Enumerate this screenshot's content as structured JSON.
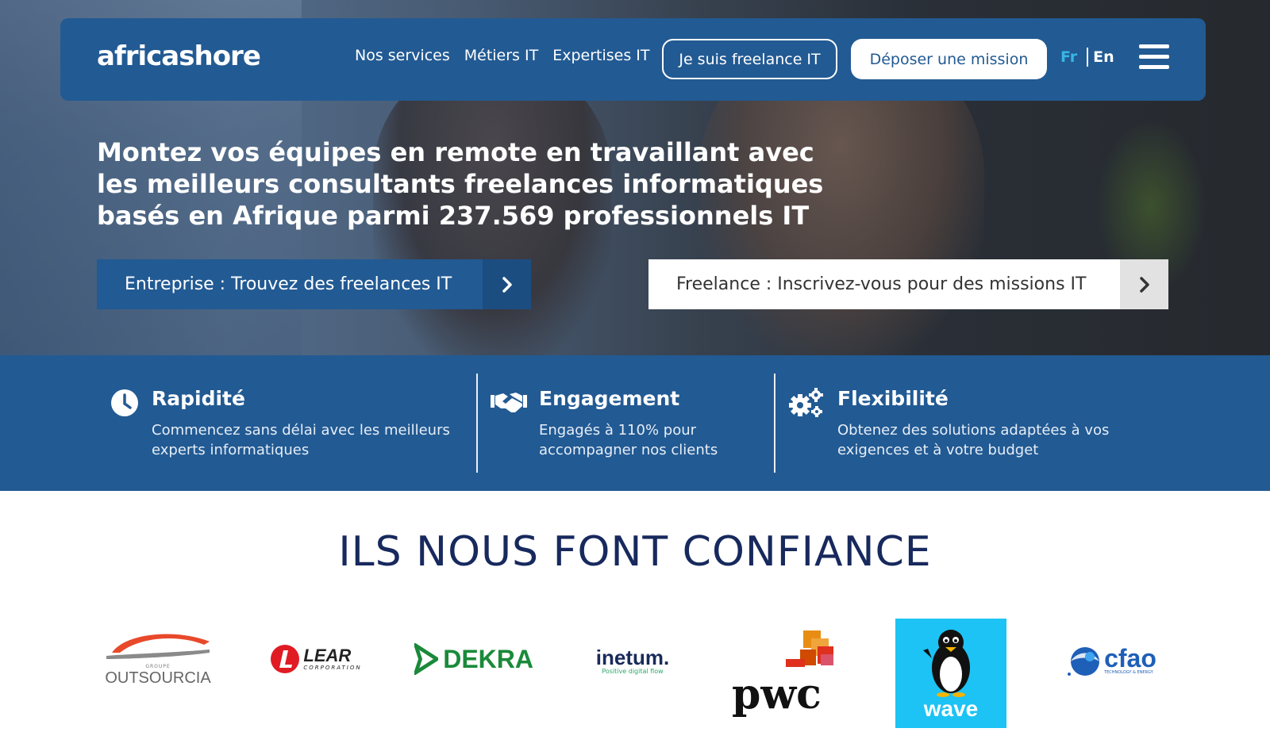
{
  "navbar": {
    "logo": "africashore",
    "links": [
      "Nos services",
      "Métiers IT",
      "Expertises IT"
    ],
    "freelance_button": "Je suis freelance IT",
    "mission_button": "Déposer une mission",
    "lang_fr": "Fr",
    "lang_en": "En",
    "menu_icon": "hamburger-menu-icon"
  },
  "hero": {
    "headline": "Montez vos équipes en remote en travaillant avec les meilleurs consultants freelances informatiques basés en Afrique parmi 237.569 professionnels IT",
    "cta_enterprise": "Entreprise : Trouvez des freelances IT",
    "cta_freelance": "Freelance : Inscrivez-vous pour des missions IT",
    "arrow_icon": "chevron-right-icon"
  },
  "features": [
    {
      "icon": "clock-icon",
      "title": "Rapidité",
      "description": "Commencez sans délai avec les meilleurs experts informatiques"
    },
    {
      "icon": "handshake-icon",
      "title": "Engagement",
      "description": "Engagés à 110% pour accompagner nos clients"
    },
    {
      "icon": "gears-icon",
      "title": "Flexibilité",
      "description": "Obtenez des solutions adaptées à vos exigences et à votre budget"
    }
  ],
  "trust": {
    "title": "ILS NOUS FONT CONFIANCE",
    "logos": [
      {
        "name": "OUTSOURCIA",
        "sub": "GROUPE"
      },
      {
        "name": "LEAR",
        "sub": "CORPORATION"
      },
      {
        "name": "DEKRA"
      },
      {
        "name": "inetum.",
        "sub": "Positive digital flow"
      },
      {
        "name": "pwc"
      },
      {
        "name": "wave"
      },
      {
        "name": "cfao",
        "sub": "TECHNOLOGY & ENERGY"
      }
    ]
  },
  "colors": {
    "brand_blue": "#225a93",
    "accent_cyan": "#37b6e6",
    "title_navy": "#17295d"
  }
}
